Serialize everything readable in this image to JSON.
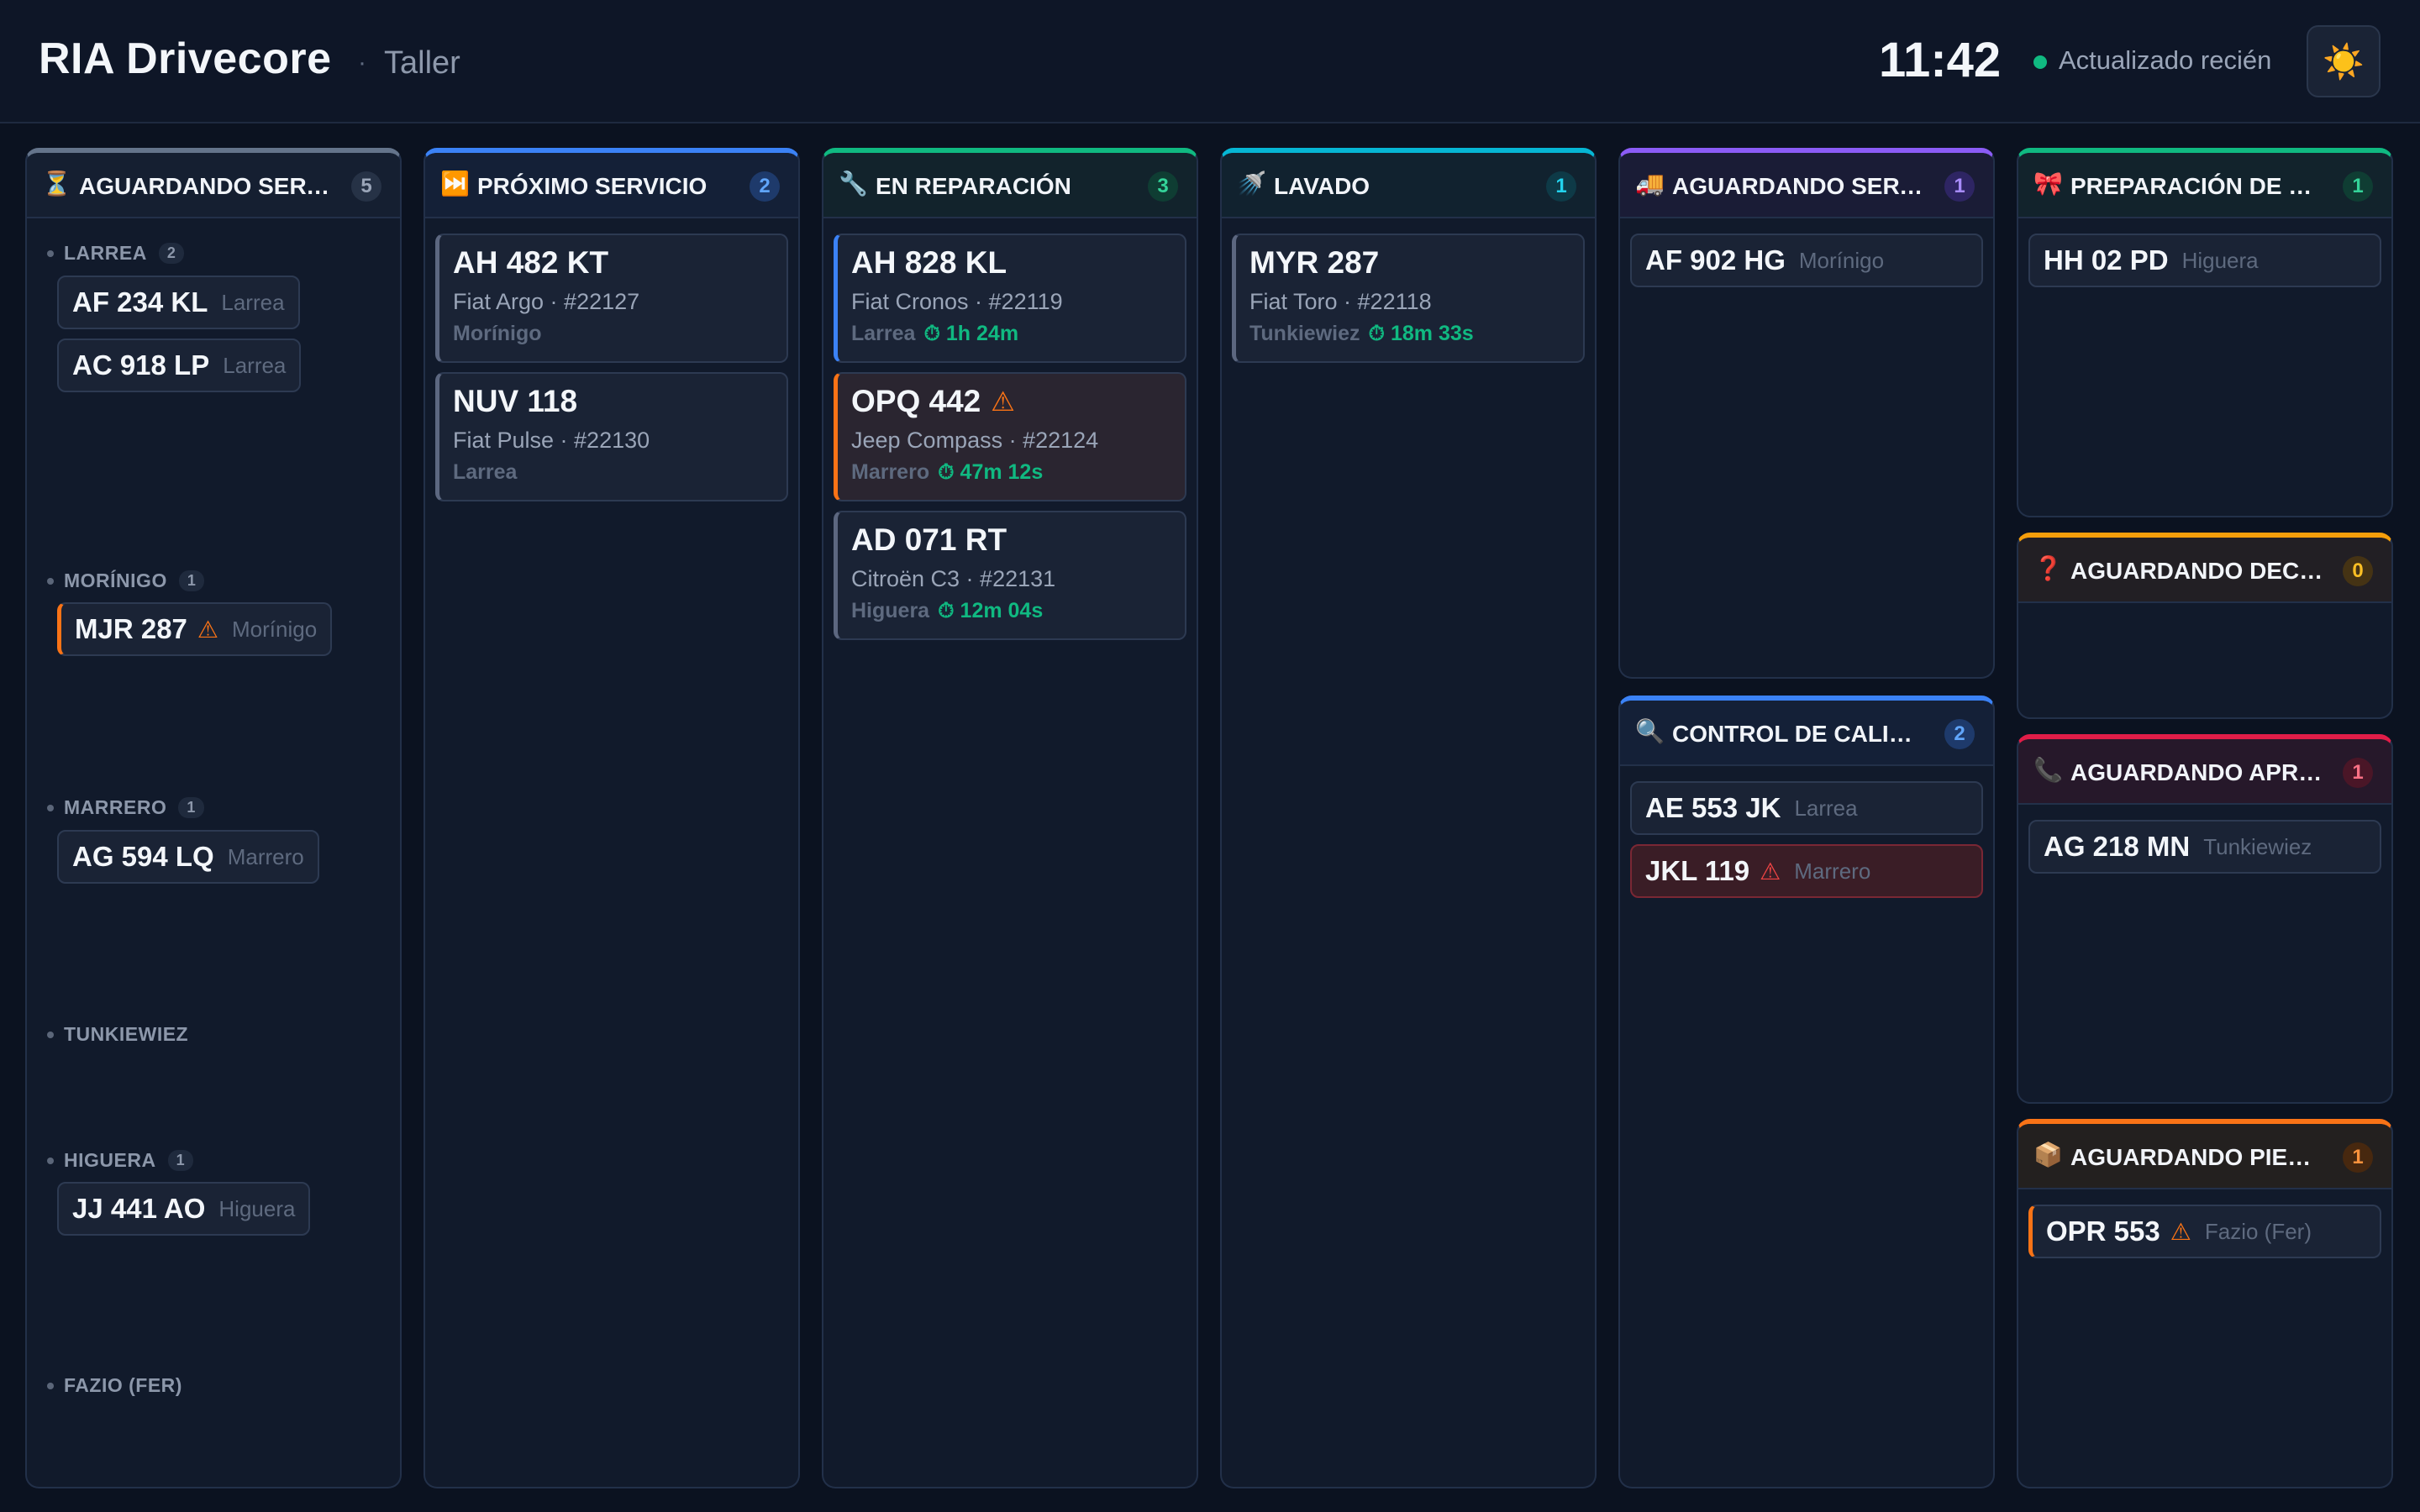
{
  "app": {
    "brand": "RIA Drivecore",
    "separator": "·",
    "section": "Taller"
  },
  "header": {
    "time": "11:42",
    "status": "Actualizado recién",
    "theme_icon": "sun-icon",
    "theme_glyph": "☀️"
  },
  "colors": {
    "blue": "#3b82f6",
    "green": "#10b981",
    "cyan": "#06b6d4",
    "purple": "#8b5cf6",
    "amber": "#f59e0b",
    "red": "#ef4444",
    "orange": "#f97316",
    "gray": "#64748b"
  },
  "columns": {
    "aguardando_servicio": {
      "icon": "⏳",
      "title": "AGUARDANDO SERV…",
      "count": "5",
      "groups": [
        {
          "name": "LARREA",
          "count": "2",
          "items": [
            {
              "plate": "AF 234 KL",
              "tech": "Larrea"
            },
            {
              "plate": "AC 918 LP",
              "tech": "Larrea"
            }
          ]
        },
        {
          "name": "MORÍNIGO",
          "count": "1",
          "items": [
            {
              "plate": "MJR 287",
              "tech": "Morínigo",
              "warn": "⚠"
            }
          ]
        },
        {
          "name": "MARRERO",
          "count": "1",
          "items": [
            {
              "plate": "AG 594 LQ",
              "tech": "Marrero"
            }
          ]
        },
        {
          "name": "TUNKIEWIEZ"
        },
        {
          "name": "HIGUERA",
          "count": "1",
          "items": [
            {
              "plate": "JJ 441 AO",
              "tech": "Higuera"
            }
          ]
        },
        {
          "name": "FAZIO (FER)"
        }
      ]
    },
    "proximo_servicio": {
      "icon": "⏭️",
      "title": "PRÓXIMO SERVICIO",
      "count": "2",
      "cards": [
        {
          "plate": "AH 482 KT",
          "model": "Fiat Argo · #22127",
          "tech": "Morínigo"
        },
        {
          "plate": "NUV 118",
          "model": "Fiat Pulse · #22130",
          "tech": "Larrea"
        }
      ]
    },
    "en_reparacion": {
      "icon": "🔧",
      "title": "EN REPARACIÓN",
      "count": "3",
      "cards": [
        {
          "plate": "AH 828 KL",
          "model": "Fiat Cronos · #22119",
          "tech": "Larrea",
          "timer": "⏱ 1h 24m"
        },
        {
          "plate": "OPQ 442",
          "warn": "⚠",
          "model": "Jeep Compass · #22124",
          "tech": "Marrero",
          "timer": "⏱ 47m 12s"
        },
        {
          "plate": "AD 071 RT",
          "model": "Citroën C3 · #22131",
          "tech": "Higuera",
          "timer": "⏱ 12m 04s"
        }
      ]
    },
    "lavado": {
      "icon": "🚿",
      "title": "LAVADO",
      "count": "1",
      "cards": [
        {
          "plate": "MYR 287",
          "model": "Fiat Toro · #22118",
          "tech": "Tunkiewiez",
          "timer": "⏱ 18m 33s"
        }
      ]
    },
    "aguardando_servicio_ext": {
      "icon": "🚚",
      "title": "AGUARDANDO SERVI…",
      "count": "1",
      "items": [
        {
          "plate": "AF 902 HG",
          "tech": "Morínigo"
        }
      ]
    },
    "control_calidad": {
      "icon": "🔍",
      "title": "CONTROL DE CALIDAD",
      "count": "2",
      "items": [
        {
          "plate": "AE 553 JK",
          "tech": "Larrea"
        },
        {
          "plate": "JKL 119",
          "tech": "Marrero",
          "warn": "⚠"
        }
      ]
    },
    "preparacion_entrega": {
      "icon": "🎀",
      "title": "PREPARACIÓN DE EN…",
      "count": "1",
      "items": [
        {
          "plate": "HH 02 PD",
          "tech": "Higuera"
        }
      ]
    },
    "aguardando_decision": {
      "icon": "❓",
      "title": "AGUARDANDO DECI…",
      "count": "0"
    },
    "aguardando_aprobacion": {
      "icon": "📞",
      "title": "AGUARDANDO APRO…",
      "count": "1",
      "items": [
        {
          "plate": "AG 218 MN",
          "tech": "Tunkiewiez"
        }
      ]
    },
    "aguardando_piezas": {
      "icon": "📦",
      "title": "AGUARDANDO PIEZAS",
      "count": "1",
      "items": [
        {
          "plate": "OPR 553",
          "tech": "Fazio (Fer)",
          "warn": "⚠"
        }
      ]
    }
  }
}
